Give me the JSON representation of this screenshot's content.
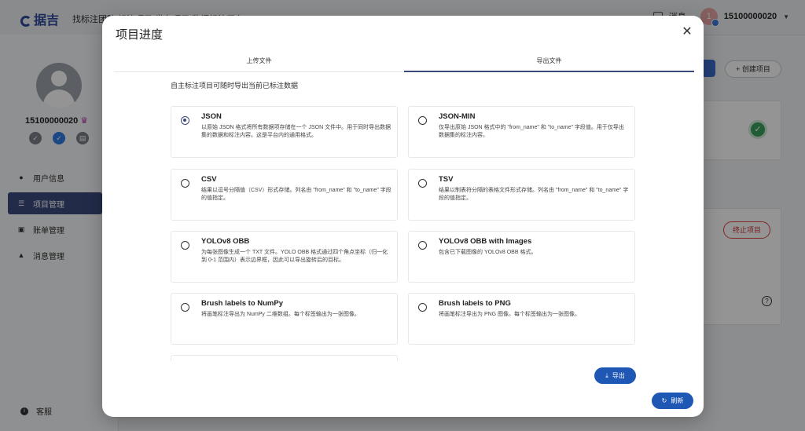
{
  "app": {
    "logo_text": "据吉",
    "nav_text": "找标注团队  标注项目  发布项目  数据标注平台",
    "header_notice": "消息",
    "user_avatar_initial": "1",
    "user_name": "15100000020"
  },
  "sidebar": {
    "user_name": "15100000020",
    "items": [
      {
        "label": "用户信息",
        "icon": "person-icon"
      },
      {
        "label": "项目管理",
        "icon": "list-icon",
        "active": true
      },
      {
        "label": "账单管理",
        "icon": "bill-icon"
      },
      {
        "label": "消息管理",
        "icon": "bell-icon"
      }
    ],
    "support_label": "客服"
  },
  "background": {
    "create_label": "+ 创建项目",
    "stop_label": "终止项目"
  },
  "modal": {
    "title": "项目进度",
    "tabs": [
      {
        "label": "上传文件"
      },
      {
        "label": "导出文件",
        "active": true
      }
    ],
    "hint": "自主标注项目可随时导出当前已标注数据",
    "options": [
      {
        "name": "JSON",
        "desc": "以原始 JSON 格式将所有数据项存储在一个 JSON 文件中。用于同时导出数据集的数据和标注内容。这是平台内的通用格式。",
        "checked": true
      },
      {
        "name": "JSON-MIN",
        "desc": "仅导出原始 JSON 格式中的 \"from_name\" 和 \"to_name\" 字段值。用于仅导出数据集的标注内容。",
        "checked": false
      },
      {
        "name": "CSV",
        "desc": "结果以逗号分隔值（CSV）形式存储。列名由 \"from_name\" 和 \"to_name\" 字段的值指定。",
        "checked": false
      },
      {
        "name": "TSV",
        "desc": "结果以制表符分隔的表格文件形式存储。列名由 \"from_name\" 和 \"to_name\" 字段的值指定。",
        "checked": false
      },
      {
        "name": "YOLOv8 OBB",
        "desc": "为每张图像生成一个 TXT 文件。YOLO OBB 格式通过四个角点坐标（归一化到 0-1 范围内）表示边界框，因此可以导出旋转后的目标。",
        "checked": false
      },
      {
        "name": "YOLOv8 OBB with Images",
        "desc": "包含已下载图像的 YOLOv8 OBB 格式。",
        "checked": false
      },
      {
        "name": "Brush labels to NumPy",
        "desc": "将画笔标注导出为 NumPy 二维数组。每个标签输出为一张图像。",
        "checked": false
      },
      {
        "name": "Brush labels to PNG",
        "desc": "将画笔标注导出为 PNG 图像。每个标签输出为一张图像。",
        "checked": false
      }
    ],
    "export_label": "导出",
    "refresh_label": "刷新"
  }
}
